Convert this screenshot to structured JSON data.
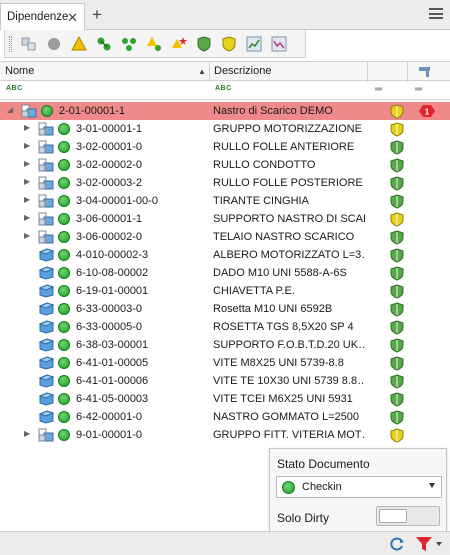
{
  "tab": {
    "label": "Dipendenze"
  },
  "columns": {
    "nome": "Nome",
    "descrizione": "Descrizione",
    "filter_abc": "ABC"
  },
  "rows": [
    {
      "code": "2-01-00001-1",
      "desc": "Nastro di Scarico DEMO",
      "level": 0,
      "expander": "open",
      "kind": "assembly",
      "shield": "yellow",
      "selected": true,
      "badge": "1"
    },
    {
      "code": "3-01-00001-1",
      "desc": "GRUPPO MOTORIZZAZIONE …",
      "level": 1,
      "expander": "closed",
      "kind": "assembly",
      "shield": "yellow"
    },
    {
      "code": "3-02-00001-0",
      "desc": "RULLO FOLLE ANTERIORE",
      "level": 1,
      "expander": "closed",
      "kind": "assembly",
      "shield": "green"
    },
    {
      "code": "3-02-00002-0",
      "desc": "RULLO CONDOTTO",
      "level": 1,
      "expander": "closed",
      "kind": "assembly",
      "shield": "green"
    },
    {
      "code": "3-02-00003-2",
      "desc": "RULLO FOLLE POSTERIORE",
      "level": 1,
      "expander": "closed",
      "kind": "assembly",
      "shield": "green"
    },
    {
      "code": "3-04-00001-00-0",
      "desc": "TIRANTE CINGHIA",
      "level": 1,
      "expander": "closed",
      "kind": "assembly",
      "shield": "green"
    },
    {
      "code": "3-06-00001-1",
      "desc": "SUPPORTO NASTRO DI SCAR…",
      "level": 1,
      "expander": "closed",
      "kind": "assembly",
      "shield": "yellow"
    },
    {
      "code": "3-06-00002-0",
      "desc": "TELAIO NASTRO SCARICO",
      "level": 1,
      "expander": "closed",
      "kind": "assembly",
      "shield": "green"
    },
    {
      "code": "4-010-00002-3",
      "desc": "ALBERO MOTORIZZATO L=3…",
      "level": 1,
      "expander": "none",
      "kind": "part",
      "shield": "green"
    },
    {
      "code": "6-10-08-00002",
      "desc": "DADO M10 UNI 5588-A-6S",
      "level": 1,
      "expander": "none",
      "kind": "part",
      "shield": "green"
    },
    {
      "code": "6-19-01-00001",
      "desc": "CHIAVETTA                P.E.",
      "level": 1,
      "expander": "none",
      "kind": "part",
      "shield": "green"
    },
    {
      "code": "6-33-00003-0",
      "desc": "Rosetta M10 UNI 6592B",
      "level": 1,
      "expander": "none",
      "kind": "part",
      "shield": "green"
    },
    {
      "code": "6-33-00005-0",
      "desc": "ROSETTA TGS 8,5X20 SP 4",
      "level": 1,
      "expander": "none",
      "kind": "part",
      "shield": "green"
    },
    {
      "code": "6-38-03-00001",
      "desc": "SUPPORTO F.O.B.T.D.20 UK…",
      "level": 1,
      "expander": "none",
      "kind": "part",
      "shield": "green"
    },
    {
      "code": "6-41-01-00005",
      "desc": "VITE   M8X25 UNI 5739-8.8",
      "level": 1,
      "expander": "none",
      "kind": "part",
      "shield": "green"
    },
    {
      "code": "6-41-01-00006",
      "desc": "VITE TE  10X30 UNI 5739 8.8…",
      "level": 1,
      "expander": "none",
      "kind": "part",
      "shield": "green"
    },
    {
      "code": "6-41-05-00003",
      "desc": "VITE TCEI M6X25 UNI 5931",
      "level": 1,
      "expander": "none",
      "kind": "part",
      "shield": "green"
    },
    {
      "code": "6-42-00001-0",
      "desc": "NASTRO GOMMATO L=2500",
      "level": 1,
      "expander": "none",
      "kind": "part",
      "shield": "green"
    },
    {
      "code": "9-01-00001-0",
      "desc": "GRUPPO FITT. VITERIA MOT…",
      "level": 1,
      "expander": "closed",
      "kind": "assembly",
      "shield": "yellow"
    }
  ],
  "popup": {
    "title": "Stato Documento",
    "selected": "Checkin",
    "solo_dirty": "Solo Dirty"
  },
  "colors": {
    "selected_row": "#f08a8a",
    "status_green": "#1f9e2a",
    "shield_green": "#58a84a",
    "shield_yellow": "#e6d21a"
  }
}
